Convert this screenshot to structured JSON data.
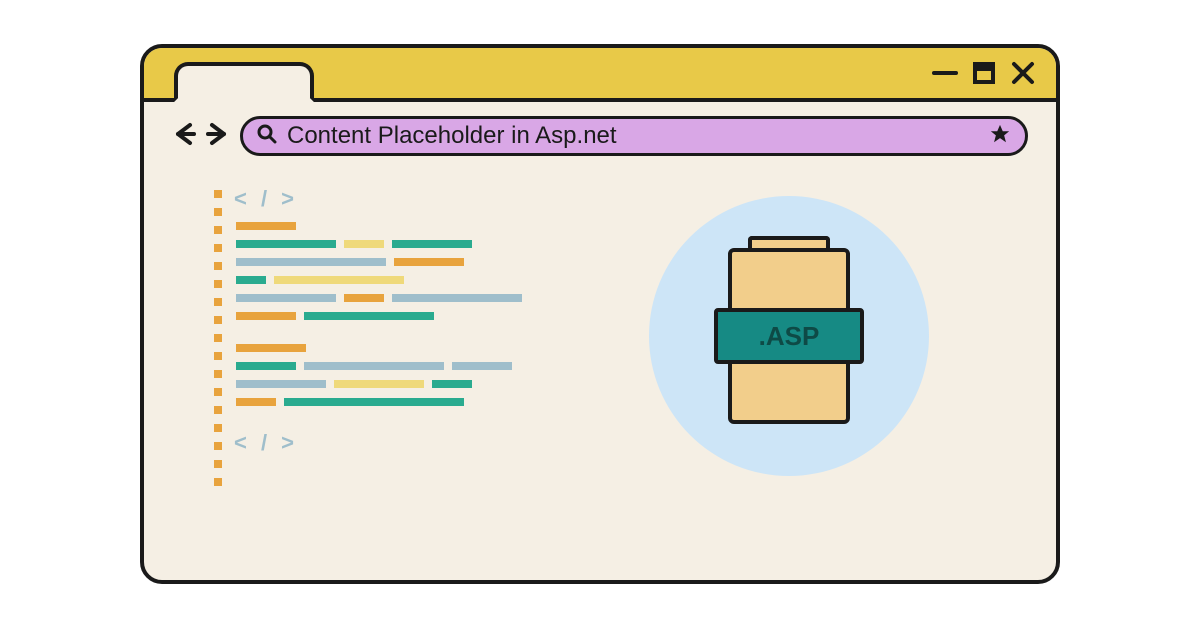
{
  "addressbar": {
    "text": "Content Placeholder in Asp.net"
  },
  "file": {
    "extension_label": ".ASP"
  },
  "icons": {
    "minimize": "minimize",
    "maximize": "maximize",
    "close": "close",
    "back": "back",
    "forward": "forward",
    "search": "search",
    "star": "star"
  }
}
